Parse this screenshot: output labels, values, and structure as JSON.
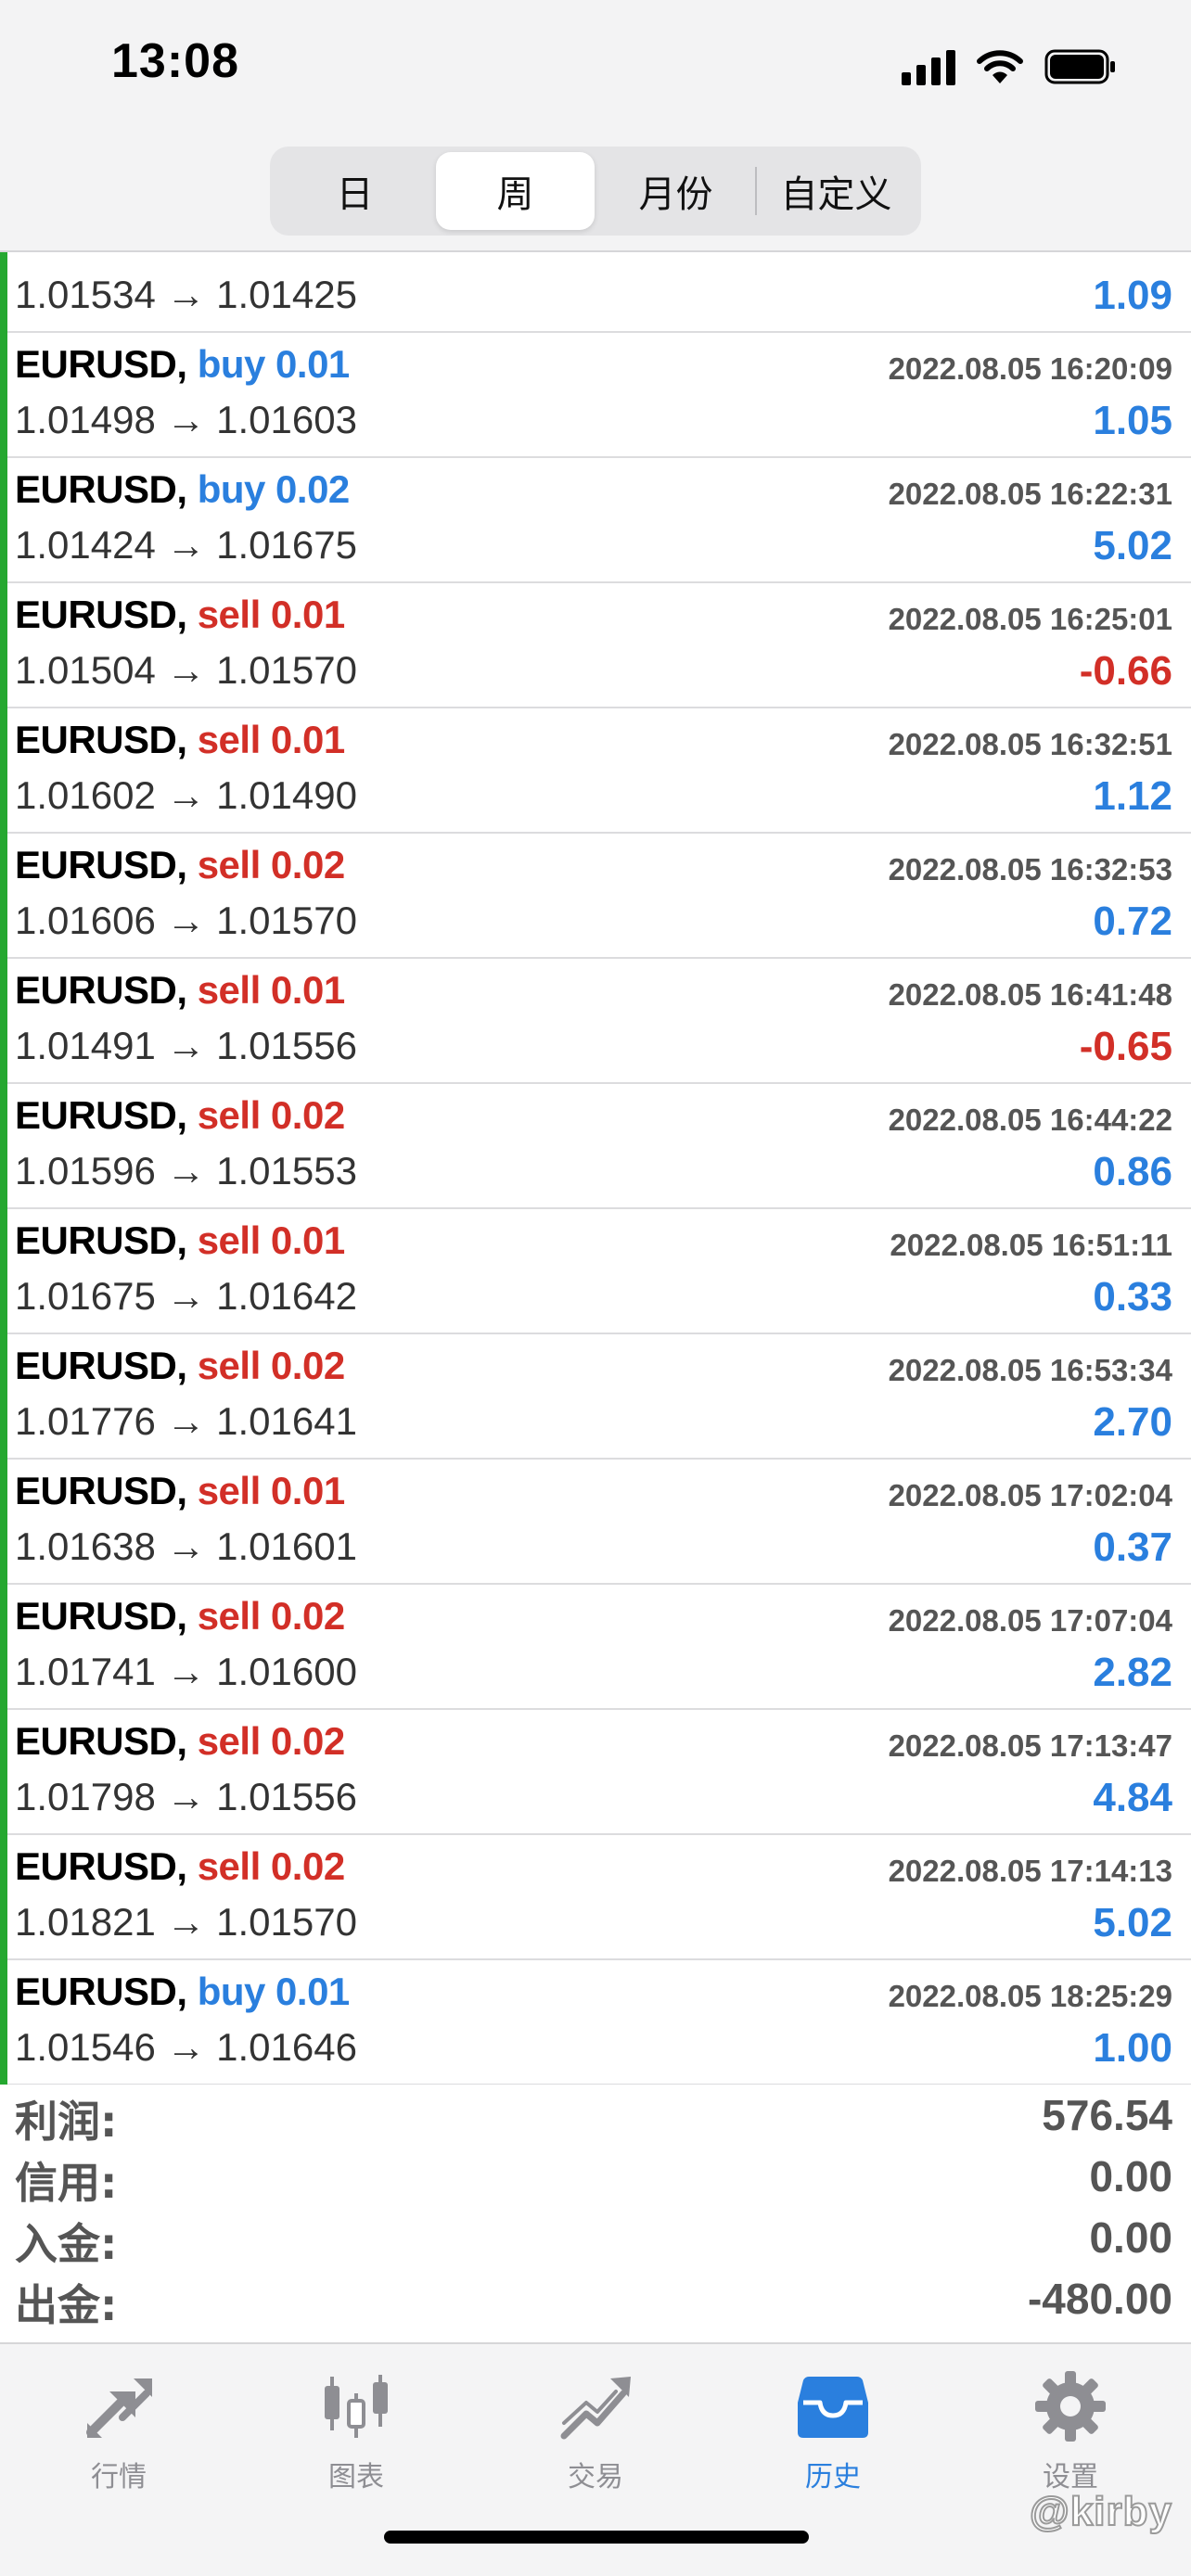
{
  "status_bar": {
    "time": "13:08"
  },
  "segments": [
    {
      "label": "日",
      "active": false
    },
    {
      "label": "周",
      "active": true
    },
    {
      "label": "月份",
      "active": false
    },
    {
      "label": "自定义",
      "active": false
    }
  ],
  "partial_row": {
    "prices": "1.01534 → 1.01425",
    "profit": "1.09"
  },
  "deals": [
    {
      "symbol": "EURUSD,",
      "direction": "buy 0.01",
      "type": "buy",
      "time": "2022.08.05 16:20:09",
      "prices": "1.01498 → 1.01603",
      "profit": "1.05",
      "sign": "pos"
    },
    {
      "symbol": "EURUSD,",
      "direction": "buy 0.02",
      "type": "buy",
      "time": "2022.08.05 16:22:31",
      "prices": "1.01424 → 1.01675",
      "profit": "5.02",
      "sign": "pos"
    },
    {
      "symbol": "EURUSD,",
      "direction": "sell 0.01",
      "type": "sell",
      "time": "2022.08.05 16:25:01",
      "prices": "1.01504 → 1.01570",
      "profit": "-0.66",
      "sign": "neg"
    },
    {
      "symbol": "EURUSD,",
      "direction": "sell 0.01",
      "type": "sell",
      "time": "2022.08.05 16:32:51",
      "prices": "1.01602 → 1.01490",
      "profit": "1.12",
      "sign": "pos"
    },
    {
      "symbol": "EURUSD,",
      "direction": "sell 0.02",
      "type": "sell",
      "time": "2022.08.05 16:32:53",
      "prices": "1.01606 → 1.01570",
      "profit": "0.72",
      "sign": "pos"
    },
    {
      "symbol": "EURUSD,",
      "direction": "sell 0.01",
      "type": "sell",
      "time": "2022.08.05 16:41:48",
      "prices": "1.01491 → 1.01556",
      "profit": "-0.65",
      "sign": "neg"
    },
    {
      "symbol": "EURUSD,",
      "direction": "sell 0.02",
      "type": "sell",
      "time": "2022.08.05 16:44:22",
      "prices": "1.01596 → 1.01553",
      "profit": "0.86",
      "sign": "pos"
    },
    {
      "symbol": "EURUSD,",
      "direction": "sell 0.01",
      "type": "sell",
      "time": "2022.08.05 16:51:11",
      "prices": "1.01675 → 1.01642",
      "profit": "0.33",
      "sign": "pos"
    },
    {
      "symbol": "EURUSD,",
      "direction": "sell 0.02",
      "type": "sell",
      "time": "2022.08.05 16:53:34",
      "prices": "1.01776 → 1.01641",
      "profit": "2.70",
      "sign": "pos"
    },
    {
      "symbol": "EURUSD,",
      "direction": "sell 0.01",
      "type": "sell",
      "time": "2022.08.05 17:02:04",
      "prices": "1.01638 → 1.01601",
      "profit": "0.37",
      "sign": "pos"
    },
    {
      "symbol": "EURUSD,",
      "direction": "sell 0.02",
      "type": "sell",
      "time": "2022.08.05 17:07:04",
      "prices": "1.01741 → 1.01600",
      "profit": "2.82",
      "sign": "pos"
    },
    {
      "symbol": "EURUSD,",
      "direction": "sell 0.02",
      "type": "sell",
      "time": "2022.08.05 17:13:47",
      "prices": "1.01798 → 1.01556",
      "profit": "4.84",
      "sign": "pos"
    },
    {
      "symbol": "EURUSD,",
      "direction": "sell 0.02",
      "type": "sell",
      "time": "2022.08.05 17:14:13",
      "prices": "1.01821 → 1.01570",
      "profit": "5.02",
      "sign": "pos"
    },
    {
      "symbol": "EURUSD,",
      "direction": "buy 0.01",
      "type": "buy",
      "time": "2022.08.05 18:25:29",
      "prices": "1.01546 → 1.01646",
      "profit": "1.00",
      "sign": "pos"
    }
  ],
  "summary": [
    {
      "label": "利润:",
      "value": "576.54"
    },
    {
      "label": "信用:",
      "value": "0.00"
    },
    {
      "label": "入金:",
      "value": "0.00"
    },
    {
      "label": "出金:",
      "value": "-480.00"
    }
  ],
  "tabs": [
    {
      "label": "行情",
      "icon": "quotes-arrows-icon",
      "active": false
    },
    {
      "label": "图表",
      "icon": "chart-candles-icon",
      "active": false
    },
    {
      "label": "交易",
      "icon": "trade-trend-icon",
      "active": false
    },
    {
      "label": "历史",
      "icon": "history-inbox-icon",
      "active": true
    },
    {
      "label": "设置",
      "icon": "gear-icon",
      "active": false
    }
  ],
  "watermark": "@kirby",
  "colors": {
    "buy": "#2a7fde",
    "sell": "#d22f27",
    "accent": "#2a7fde",
    "bar": "#25a830"
  }
}
